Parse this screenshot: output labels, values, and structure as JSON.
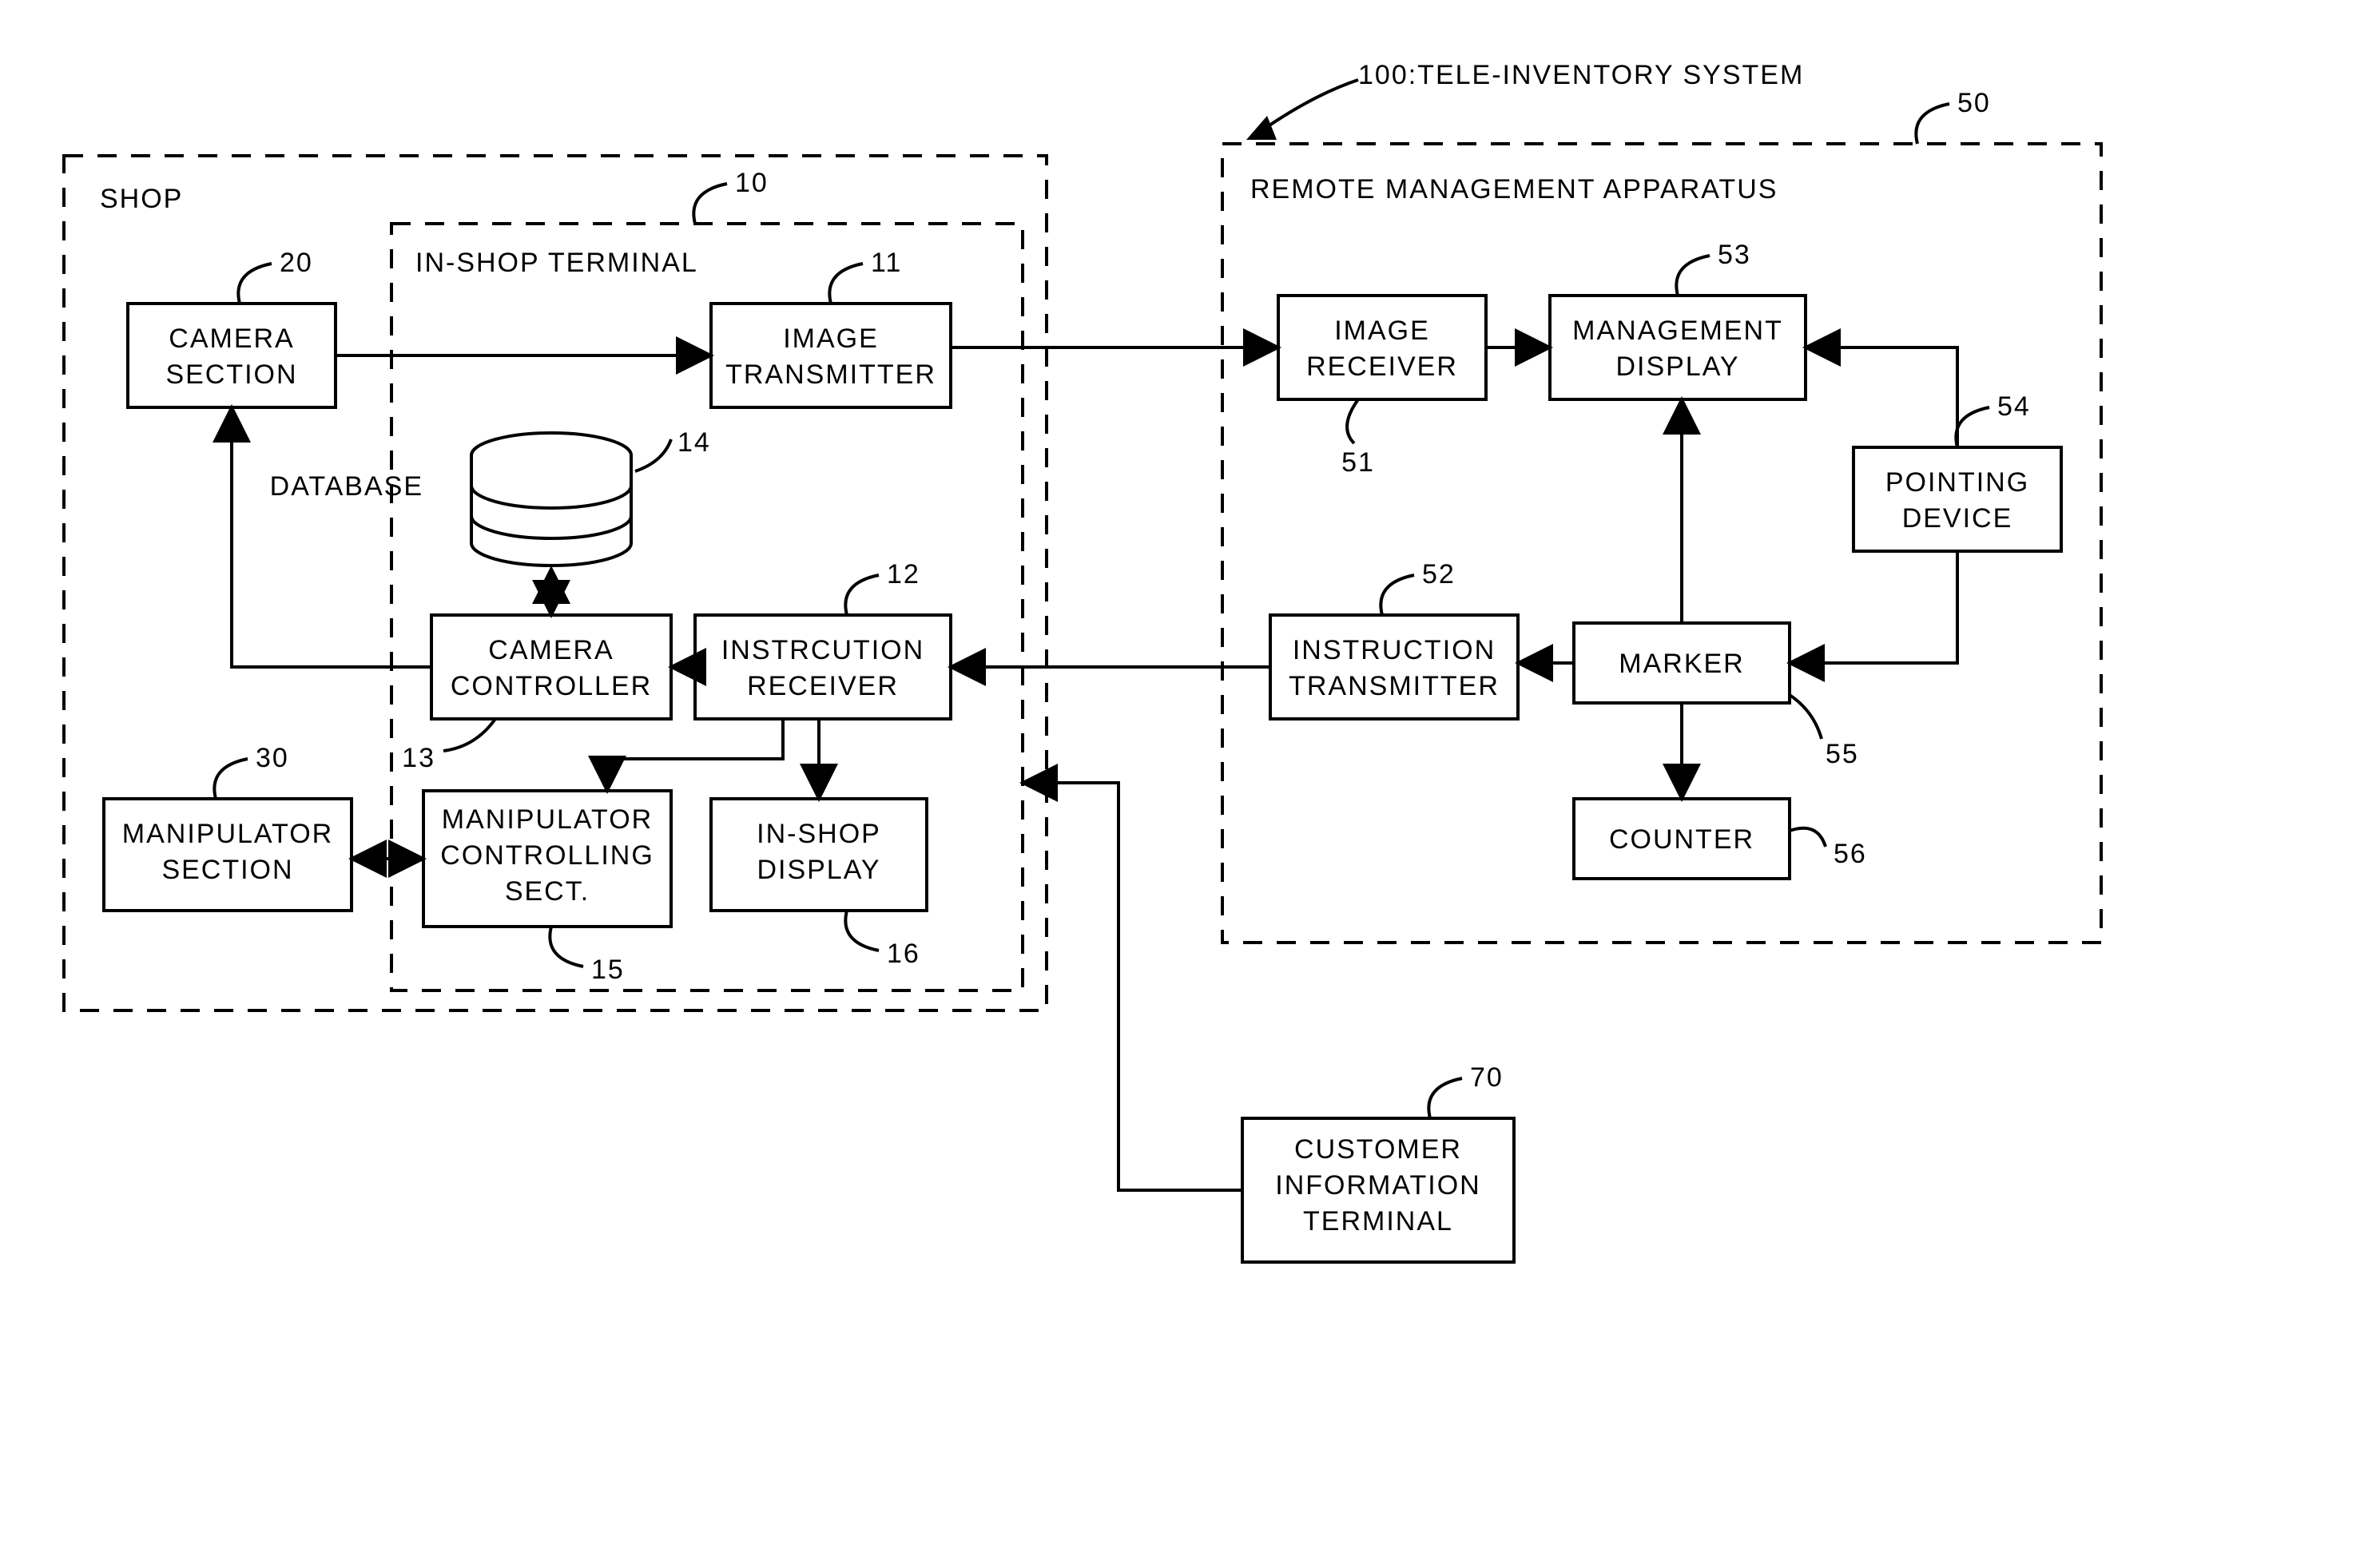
{
  "title": {
    "num": "100",
    "text": ":TELE-INVENTORY SYSTEM"
  },
  "shop": {
    "label": "SHOP",
    "terminal": {
      "label": "IN-SHOP TERMINAL",
      "num": "10"
    },
    "camera_section": {
      "label1": "CAMERA",
      "label2": "SECTION",
      "num": "20"
    },
    "image_tx": {
      "label1": "IMAGE",
      "label2": "TRANSMITTER",
      "num": "11"
    },
    "database": {
      "label": "DATABASE",
      "num": "14"
    },
    "instr_rx": {
      "label1": "INSTRCUTION",
      "label2": "RECEIVER",
      "num": "12"
    },
    "cam_ctrl": {
      "label1": "CAMERA",
      "label2": "CONTROLLER",
      "num": "13"
    },
    "manip_ctrl": {
      "label1": "MANIPULATOR",
      "label2": "CONTROLLING",
      "label3": "SECT.",
      "num": "15"
    },
    "inshop_disp": {
      "label1": "IN-SHOP",
      "label2": "DISPLAY",
      "num": "16"
    },
    "manip_sect": {
      "label1": "MANIPULATOR",
      "label2": "SECTION",
      "num": "30"
    }
  },
  "remote": {
    "label": "REMOTE MANAGEMENT APPARATUS",
    "num": "50",
    "image_rx": {
      "label1": "IMAGE",
      "label2": "RECEIVER",
      "num": "51"
    },
    "mgmt_disp": {
      "label1": "MANAGEMENT",
      "label2": "DISPLAY",
      "num": "53"
    },
    "pointing": {
      "label1": "POINTING",
      "label2": "DEVICE",
      "num": "54"
    },
    "instr_tx": {
      "label1": "INSTRUCTION",
      "label2": "TRANSMITTER",
      "num": "52"
    },
    "marker": {
      "label": "MARKER",
      "num": "55"
    },
    "counter": {
      "label": "COUNTER",
      "num": "56"
    }
  },
  "customer": {
    "label1": "CUSTOMER",
    "label2": "INFORMATION",
    "label3": "TERMINAL",
    "num": "70"
  }
}
